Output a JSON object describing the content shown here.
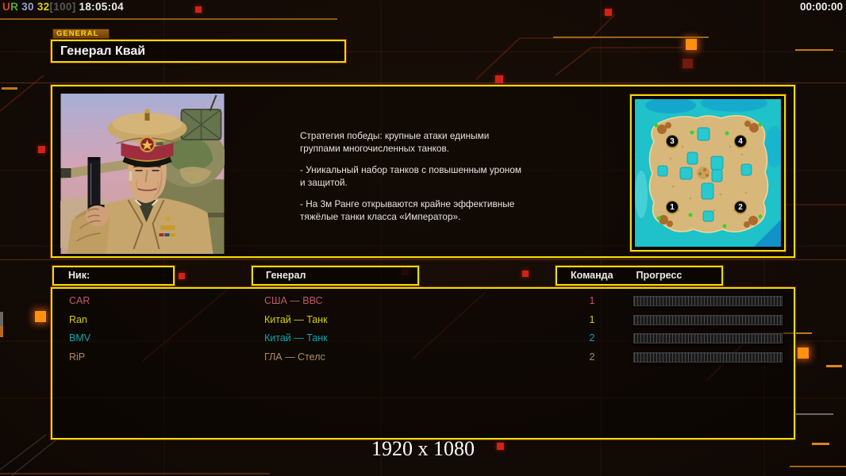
{
  "top_bar": {
    "left_stats": [
      {
        "text": "U",
        "color": "#d2491c"
      },
      {
        "text": "R",
        "color": "#4fae2a"
      },
      {
        "text": " 30",
        "color": "#8fa8d0"
      },
      {
        "text": " 32",
        "color": "#ddd000"
      },
      {
        "text": "[100]",
        "color": "#575757"
      },
      {
        "text": " 18:05:04",
        "color": "#ececec"
      }
    ],
    "timer": "00:00:00"
  },
  "general_panel": {
    "tab_label": "GENERAL",
    "title": "Генерал Квай",
    "description_paragraphs": [
      "Стратегия победы: крупные атаки едиными\n группами многочисленных танков.",
      "- Уникальный набор танков с повышенным уроном\n и защитой.",
      "- На 3м Ранге открываются крайне эффективные\n тяжёлые танки класса «Император»."
    ]
  },
  "minimap": {
    "start_positions": [
      {
        "num": "3"
      },
      {
        "num": "4"
      },
      {
        "num": "1"
      },
      {
        "num": "2"
      }
    ]
  },
  "players_table": {
    "headers": {
      "nick": "Ник:",
      "general": "Генерал",
      "team": "Команда",
      "progress": "Прогресс"
    },
    "rows": [
      {
        "nick": "CAR",
        "general": "США — ВВС",
        "team": "1",
        "color": "#bd5a69",
        "progress": 0
      },
      {
        "nick": "Ran",
        "general": "Китай — Танк",
        "team": "1",
        "color": "#d6cf00",
        "progress": 0
      },
      {
        "nick": "BMV",
        "general": "Китай — Танк",
        "team": "2",
        "color": "#0ba6ae",
        "progress": 0
      },
      {
        "nick": "RiP",
        "general": "ГЛА — Стелс",
        "team": "2",
        "color": "#ad8c62",
        "progress": 0
      }
    ]
  },
  "footer": {
    "resolution_label": "1920 x 1080"
  },
  "colors": {
    "accent_yellow": "#e6de00",
    "accent_orange": "#ff9012",
    "accent_red": "#cf2318",
    "map_water": "#1ec2c8",
    "map_sand": "#d8b87a"
  }
}
